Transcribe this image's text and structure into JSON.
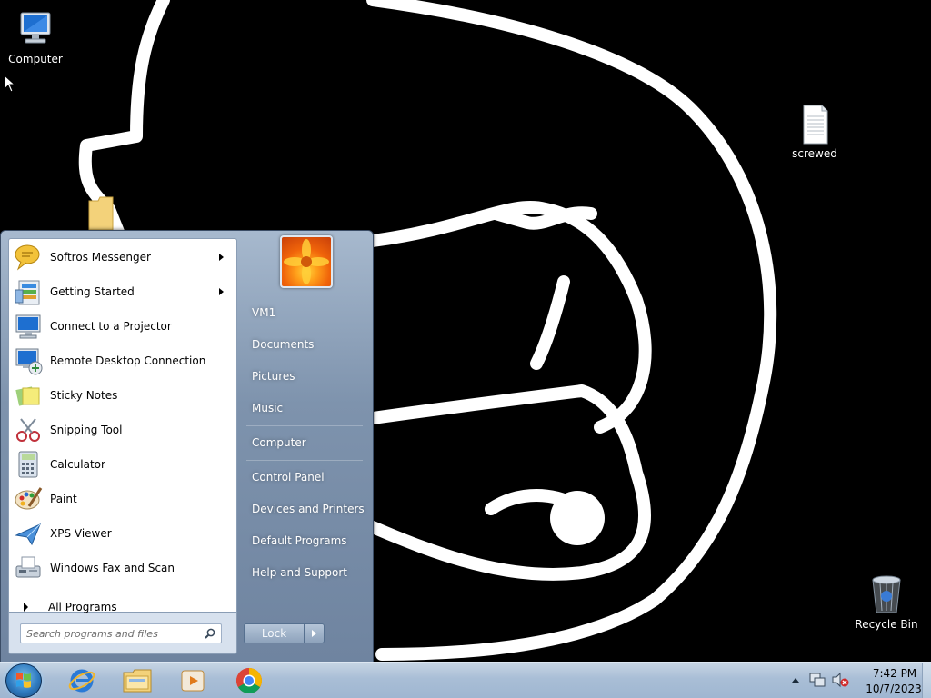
{
  "desktop": {
    "icons": [
      {
        "label": "Computer"
      },
      {
        "label": "screwed"
      },
      {
        "label": "Recycle Bin"
      }
    ]
  },
  "start_menu": {
    "programs": [
      {
        "label": "Softros Messenger",
        "icon": "speech-bubble-icon",
        "has_submenu": true
      },
      {
        "label": "Getting Started",
        "icon": "getting-started-icon",
        "has_submenu": true
      },
      {
        "label": "Connect to a Projector",
        "icon": "projector-monitor-icon",
        "has_submenu": false
      },
      {
        "label": "Remote Desktop Connection",
        "icon": "remote-desktop-icon",
        "has_submenu": false
      },
      {
        "label": "Sticky Notes",
        "icon": "sticky-notes-icon",
        "has_submenu": false
      },
      {
        "label": "Snipping Tool",
        "icon": "scissors-icon",
        "has_submenu": false
      },
      {
        "label": "Calculator",
        "icon": "calculator-icon",
        "has_submenu": false
      },
      {
        "label": "Paint",
        "icon": "paint-palette-icon",
        "has_submenu": false
      },
      {
        "label": "XPS Viewer",
        "icon": "xps-viewer-icon",
        "has_submenu": false
      },
      {
        "label": "Windows Fax and Scan",
        "icon": "fax-icon",
        "has_submenu": false
      }
    ],
    "all_programs_label": "All Programs",
    "search": {
      "placeholder": "Search programs and files"
    },
    "right_links": {
      "vm1": "VM1",
      "documents": "Documents",
      "pictures": "Pictures",
      "music": "Music",
      "computer": "Computer",
      "control_panel": "Control Panel",
      "devices_printers": "Devices and Printers",
      "default_programs": "Default Programs",
      "help_support": "Help and Support"
    },
    "lock_label": "Lock"
  },
  "taskbar": {
    "apps": [
      "internet-explorer-icon",
      "file-explorer-icon",
      "media-player-icon",
      "chrome-icon"
    ],
    "clock": {
      "time": "7:42 PM",
      "date": "10/7/2023"
    }
  },
  "colors": {
    "taskbar": "#a9bed6",
    "start_menu_right_pane": "#7e93ad",
    "desktop_background": "#000000"
  }
}
